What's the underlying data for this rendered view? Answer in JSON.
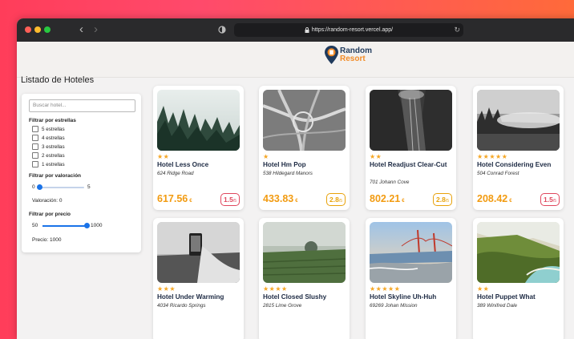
{
  "browser": {
    "url": "https://random-resort.vercel.app/"
  },
  "logo": {
    "line1": "Random",
    "line2": "Resort"
  },
  "page": {
    "title": "Listado de Hoteles"
  },
  "filters": {
    "search_placeholder": "Buscar hotel...",
    "stars_label": "Filtrar por estrellas",
    "star_options": [
      "5 estrellas",
      "4 estrellas",
      "3 estrellas",
      "2 estrellas",
      "1 estrellas"
    ],
    "rating_label": "Filtrar por valoración",
    "rating_min": "0",
    "rating_max": "5",
    "rating_value_text": "Valoración: 0",
    "rating_fraction": 0,
    "price_label": "Filtrar por precio",
    "price_min": "50",
    "price_max": "1000",
    "price_value_text": "Precio: 1000",
    "price_fraction": 1
  },
  "hotels": [
    {
      "stars": "★★",
      "name": "Hotel Less Once",
      "address": "624 Ridge Road",
      "price": "617.56",
      "currency": "€",
      "rating": "1.5",
      "rating_suffix": "/5"
    },
    {
      "stars": "★",
      "name": "Hotel Hm Pop",
      "address": "538 Hildegard Manors",
      "price": "433.83",
      "currency": "€",
      "rating": "2.8",
      "rating_suffix": "/5"
    },
    {
      "stars": "★★",
      "name": "Hotel Readjust Clear-Cut",
      "address": "701 Johann Cove",
      "price": "802.21",
      "currency": "€",
      "rating": "2.8",
      "rating_suffix": "/5"
    },
    {
      "stars": "★★★★★",
      "name": "Hotel Considering Even",
      "address": "504 Conrad Forest",
      "price": "208.42",
      "currency": "€",
      "rating": "1.5",
      "rating_suffix": "/5"
    },
    {
      "stars": "★★★",
      "name": "Hotel Under Warming",
      "address": "4034 Ricardo Springs"
    },
    {
      "stars": "★★★★",
      "name": "Hotel Closed Slushy",
      "address": "2815 Lime Grove"
    },
    {
      "stars": "★★★★★",
      "name": "Hotel Skyline Uh-Huh",
      "address": "69269 Johan Mission"
    },
    {
      "stars": "★★",
      "name": "Hotel Puppet What",
      "address": "389 Winifred Dale"
    }
  ]
}
